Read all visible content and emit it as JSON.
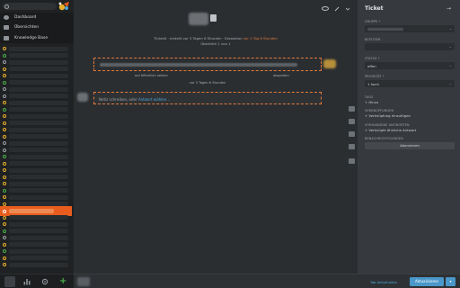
{
  "nav": {
    "menu": [
      {
        "label": "Dashboard",
        "icon": "dashboard-icon"
      },
      {
        "label": "Übersichten",
        "icon": "list-icon"
      },
      {
        "label": "Knowledge Base",
        "icon": "book-icon"
      }
    ],
    "ticket_states": [
      "open",
      "new",
      "pending",
      "open",
      "open",
      "new",
      "pending",
      "pending",
      "open",
      "new",
      "open",
      "open",
      "open",
      "open",
      "pending",
      "pending",
      "new",
      "open",
      "open",
      "open",
      "open",
      "new",
      "open",
      "open",
      "active",
      "open",
      "open",
      "new",
      "pending",
      "open",
      "new",
      "open",
      "open"
    ],
    "colors": {
      "new": "#4cae4c",
      "open": "#e8b12c",
      "pending": "#9aa0a6",
      "active": "#e85d1e"
    },
    "bottom_icons": [
      "avatar-icon",
      "stats-icon",
      "settings-icon",
      "add-icon"
    ],
    "add_glyph": "+"
  },
  "main": {
    "meta_prefix": "Ticket#",
    "meta_mid": "· erstellt vor 3 Tagen 6 Stunden · Eskalation",
    "meta_esc": "vor 1 Tag 8 Stunden",
    "meta_line2": "Überblick 1 von 1",
    "article_foot_left": "auf öffentlich setzen",
    "article_foot_right": "abspalten",
    "article_time": "vor 3 Tagen 6 Stunden",
    "reply_placeholder": "Notiz schreiben, oder",
    "reply_link": "Antwort wählen..."
  },
  "sidebar": {
    "title": "Ticket",
    "collapse_glyph": "→",
    "labels": {
      "group": "GRUPPE *",
      "owner": "BESITZER",
      "state": "STATUS *",
      "priority": "PRIORITÄT *",
      "tags": "TAGS",
      "links": "VERKNÜPFUNGEN",
      "similar": "VORHANDENE ANTWORTEN",
      "subscribers": "BENACHRICHTIGUNGEN"
    },
    "state_value": "offen",
    "priority_value": "1 hoch",
    "tag_add": "+ Hinzu",
    "links_add": "+ Verknüpfung hinzufügen",
    "similar_add": "+ Verknüpfe ähnliche Antwort",
    "unsubscribe": "Abonnieren",
    "status_link": "Tab beibehalten",
    "update_button": "Aktualisieren",
    "update_more": "▾"
  }
}
